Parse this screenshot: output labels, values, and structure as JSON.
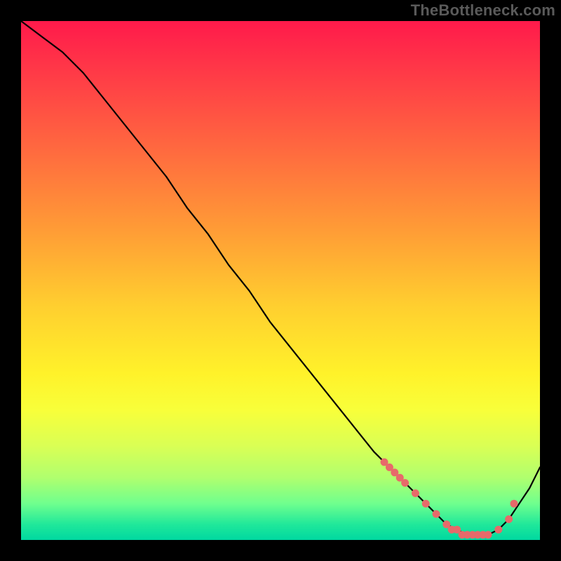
{
  "watermark": "TheBottleneck.com",
  "colors": {
    "background": "#000000",
    "curve": "#000000",
    "marker": "#e76a6a",
    "watermark": "#5a5a5a"
  },
  "chart_data": {
    "type": "line",
    "title": "",
    "xlabel": "",
    "ylabel": "",
    "xlim": [
      0,
      100
    ],
    "ylim": [
      0,
      100
    ],
    "grid": false,
    "legend": false,
    "annotations": [],
    "series": [
      {
        "name": "curve",
        "x": [
          0,
          4,
          8,
          12,
          16,
          20,
          24,
          28,
          32,
          36,
          40,
          44,
          48,
          52,
          56,
          60,
          64,
          68,
          72,
          74,
          76,
          78,
          80,
          82,
          84,
          86,
          88,
          90,
          92,
          94,
          96,
          98,
          100
        ],
        "y": [
          100,
          97,
          94,
          90,
          85,
          80,
          75,
          70,
          64,
          59,
          53,
          48,
          42,
          37,
          32,
          27,
          22,
          17,
          13,
          11,
          9,
          7,
          5,
          3,
          2,
          1,
          1,
          1,
          2,
          4,
          7,
          10,
          14
        ]
      }
    ],
    "markers": {
      "name": "highlight-points",
      "x": [
        70,
        71,
        72,
        73,
        74,
        76,
        78,
        80,
        82,
        83,
        84,
        85,
        86,
        87,
        88,
        89,
        90,
        92,
        94,
        95
      ],
      "y": [
        15,
        14,
        13,
        12,
        11,
        9,
        7,
        5,
        3,
        2,
        2,
        1,
        1,
        1,
        1,
        1,
        1,
        2,
        4,
        7
      ]
    }
  }
}
